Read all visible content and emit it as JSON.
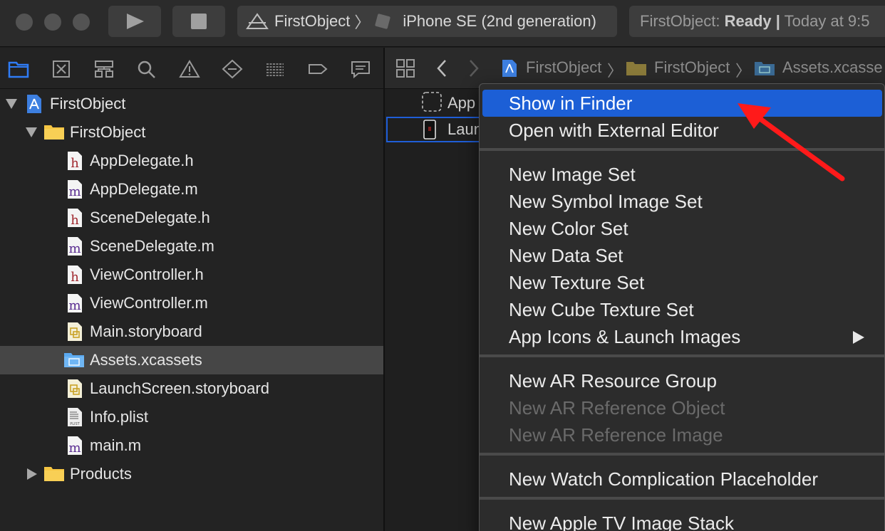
{
  "toolbar": {
    "scheme_project": "FirstObject",
    "scheme_chevron": "〉",
    "scheme_device": "iPhone SE (2nd generation)",
    "status_prefix": "FirstObject:",
    "status_state": "Ready",
    "status_sep": "|",
    "status_time": "Today at 9:5"
  },
  "navigator": {
    "items": [
      {
        "label": "FirstObject",
        "kind": "project"
      },
      {
        "label": "FirstObject",
        "kind": "folder"
      },
      {
        "label": "AppDelegate.h",
        "kind": "h"
      },
      {
        "label": "AppDelegate.m",
        "kind": "m"
      },
      {
        "label": "SceneDelegate.h",
        "kind": "h"
      },
      {
        "label": "SceneDelegate.m",
        "kind": "m"
      },
      {
        "label": "ViewController.h",
        "kind": "h"
      },
      {
        "label": "ViewController.m",
        "kind": "m"
      },
      {
        "label": "Main.storyboard",
        "kind": "storyboard"
      },
      {
        "label": "Assets.xcassets",
        "kind": "assets"
      },
      {
        "label": "LaunchScreen.storyboard",
        "kind": "storyboard"
      },
      {
        "label": "Info.plist",
        "kind": "plist"
      },
      {
        "label": "main.m",
        "kind": "m"
      },
      {
        "label": "Products",
        "kind": "folder"
      }
    ],
    "h_glyph": "h",
    "m_glyph": "m",
    "plist_glyph": "PLIST"
  },
  "editor": {
    "breadcrumb": [
      "FirstObject",
      "FirstObject",
      "Assets.xcasse"
    ],
    "crumb_chevron": "〉",
    "assets": [
      "App",
      "Laun"
    ]
  },
  "context_menu": {
    "items": [
      "Show in Finder",
      "Open with External Editor",
      "New Image Set",
      "New Symbol Image Set",
      "New Color Set",
      "New Data Set",
      "New Texture Set",
      "New Cube Texture Set",
      "App Icons & Launch Images",
      "New AR Resource Group",
      "New AR Reference Object",
      "New AR Reference Image",
      "New Watch Complication Placeholder",
      "New Apple TV Image Stack"
    ],
    "highlighted": "Show in Finder",
    "disabled": [
      "New AR Reference Object",
      "New AR Reference Image"
    ]
  },
  "colors": {
    "highlight": "#1c5fd6",
    "annotation_arrow": "#ff1a1a",
    "folder": "#f5c542",
    "header_h": "#a0262d",
    "impl_m": "#5a2d91"
  },
  "annotation": {
    "icon": "red-arrow-icon"
  }
}
